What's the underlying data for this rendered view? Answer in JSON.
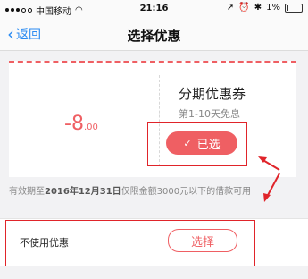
{
  "status_bar": {
    "carrier": "中国移动",
    "time": "21:16",
    "battery": "1%"
  },
  "nav": {
    "back_label": "返回",
    "title": "选择优惠"
  },
  "coupon": {
    "amount_int": "-8",
    "amount_dec": ".00",
    "name": "分期优惠券",
    "description": "第1-10天免息",
    "selected_label": "已选",
    "validity_prefix": "有效期至",
    "validity_date": "2016年12月31日",
    "validity_suffix": "仅限金额3000元以下的借款可用"
  },
  "no_coupon": {
    "label": "不使用优惠",
    "select_label": "选择"
  },
  "colors": {
    "accent": "#ef5f63",
    "link": "#2a8bf2",
    "annotation": "#e0242a"
  }
}
